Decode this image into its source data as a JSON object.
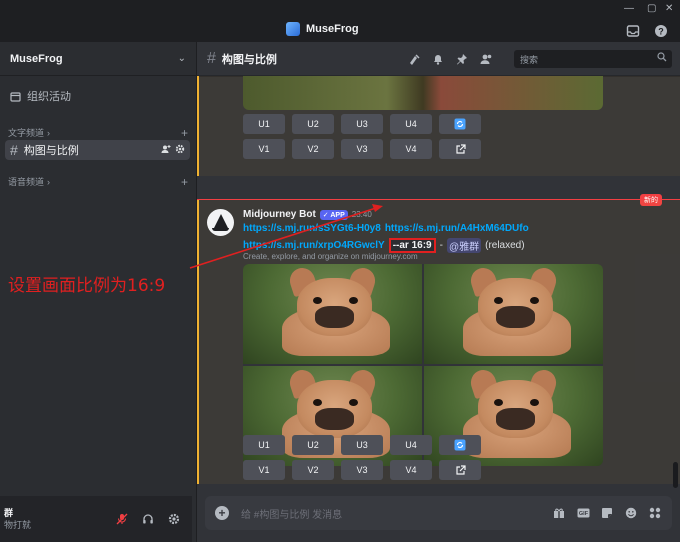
{
  "window": {
    "title": "MuseFrog",
    "controls": {
      "minimize": "—",
      "maximize": "▢",
      "close": "✕"
    }
  },
  "sidebar": {
    "server_name": "MuseFrog",
    "events_label": "组织活动",
    "text_category": "文字频道",
    "active_channel": "构图与比例",
    "voice_category": "语音频道",
    "user": {
      "name": "群",
      "status": "物打就"
    }
  },
  "channel_header": {
    "name": "构图与比例",
    "search_placeholder": "搜索"
  },
  "messages": {
    "button_rows": {
      "row1": [
        "U1",
        "U2",
        "U3",
        "U4"
      ],
      "row2": [
        "V1",
        "V2",
        "V3",
        "V4"
      ]
    },
    "new_badge": "新的",
    "bot_message": {
      "author": "Midjourney Bot",
      "badge": "APP",
      "timestamp": "23:40",
      "link1": "https://s.mj.run/sSYGt6-H0y8",
      "link2": "https://s.mj.run/A4HxM64DUfo",
      "link3": "https://s.mj.run/xrpO4RGwclY",
      "params": "--ar 16:9",
      "mention": "@雅群",
      "mode": "(relaxed)",
      "embed_description": "Create, explore, and organize on midjourney.com"
    }
  },
  "annotation": {
    "text": "设置画面比例为16:9",
    "color": "#e02020"
  },
  "composer": {
    "placeholder": "给 #构图与比例 发消息"
  },
  "colors": {
    "accent": "#5865f2",
    "link": "#00a8fc",
    "danger": "#f23f43",
    "highlight": "#f0b232"
  }
}
